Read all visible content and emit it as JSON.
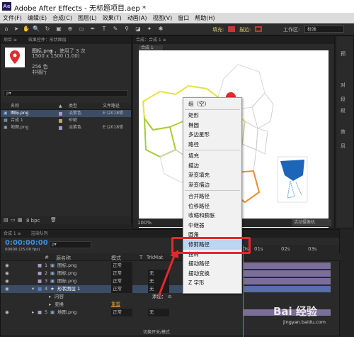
{
  "app": {
    "icon_text": "Ae",
    "title": "Adobe After Effects - 无标题项目.aep *"
  },
  "menu": [
    "文件(F)",
    "编辑(E)",
    "合成(C)",
    "图层(L)",
    "效果(T)",
    "动画(A)",
    "视图(V)",
    "窗口",
    "帮助(H)"
  ],
  "toolbar": {
    "fill_label": "填充:",
    "stroke_label": "描边:",
    "workspace_label": "工作区:",
    "workspace_value": "标准"
  },
  "project": {
    "tab": "项目 ≡",
    "tab2": "效果控件：形状图层",
    "selected_name": "图标.png",
    "selected_used": "▾ ，使用了 3 次",
    "selected_dims": "1500 x 1500 (1.00)",
    "selected_colors": "256 色",
    "selected_interlace": "非隔行",
    "search_placeholder": "ρ▾",
    "col_name": "名称",
    "col_label": "▲",
    "col_type": "类型",
    "col_path": "文件路径",
    "items": [
      {
        "name": "图标.png",
        "type": "淡紫色",
        "path": "E:\\2018修",
        "color": "#a996c6"
      },
      {
        "name": "合成 1",
        "type": "砂砺",
        "path": "",
        "color": "#b9a77a"
      },
      {
        "name": "地图.png",
        "type": "淡紫色",
        "path": "E:\\2018修",
        "color": "#a996c6"
      }
    ],
    "bpc": "8 bpc"
  },
  "viewer": {
    "tab": "合成：合成 1 ≡",
    "subtab": "合成 1",
    "active_camera": "活动摄像机",
    "zoom": "100%"
  },
  "right_panel": {
    "labels": [
      "预",
      "对",
      "段",
      "段",
      "效",
      "风"
    ]
  },
  "context_menu": {
    "groups": [
      [
        "组（空）"
      ],
      [
        "矩形",
        "椭圆",
        "多边星形",
        "路径"
      ],
      [
        "填充",
        "描边",
        "渐变填充",
        "渐变描边"
      ],
      [
        "合并路径",
        "位移路径",
        "收缩和膨胀",
        "中继器",
        "圆角",
        "修剪路径",
        "扭转",
        "摆动路径",
        "摆动变换",
        "Z 字形"
      ]
    ],
    "highlighted": "修剪路径"
  },
  "timeline": {
    "tab": "合成 1 ≡",
    "tab2": "渲染队列",
    "timecode": "0:00:00:00",
    "fps": "00000 (25.00 fps)",
    "col_num": "#",
    "col_name": "源名称",
    "col_mode": "模式",
    "col_t": "T",
    "col_trkmat": "TrkMat",
    "ruler": [
      "0s",
      "01s",
      "02s",
      "03s"
    ],
    "layers": [
      {
        "num": "1",
        "name": "图标.png",
        "mode": "正常",
        "trkmat": ""
      },
      {
        "num": "2",
        "name": "图标.png",
        "mode": "正常",
        "trkmat": "无"
      },
      {
        "num": "3",
        "name": "图标.png",
        "mode": "正常",
        "trkmat": "无"
      },
      {
        "num": "4",
        "name": "形状图层 1",
        "mode": "正常",
        "trkmat": "无"
      }
    ],
    "content_label": "内容",
    "add_label": "添加：",
    "transform_label": "变换",
    "reset_label": "重置",
    "layer5": {
      "num": "5",
      "name": "地图.png",
      "mode": "正常",
      "trkmat": "无"
    },
    "footer": "切换开关/模式"
  },
  "watermark": "Bai 经验",
  "watermark_url": "jingyan.baidu.com"
}
